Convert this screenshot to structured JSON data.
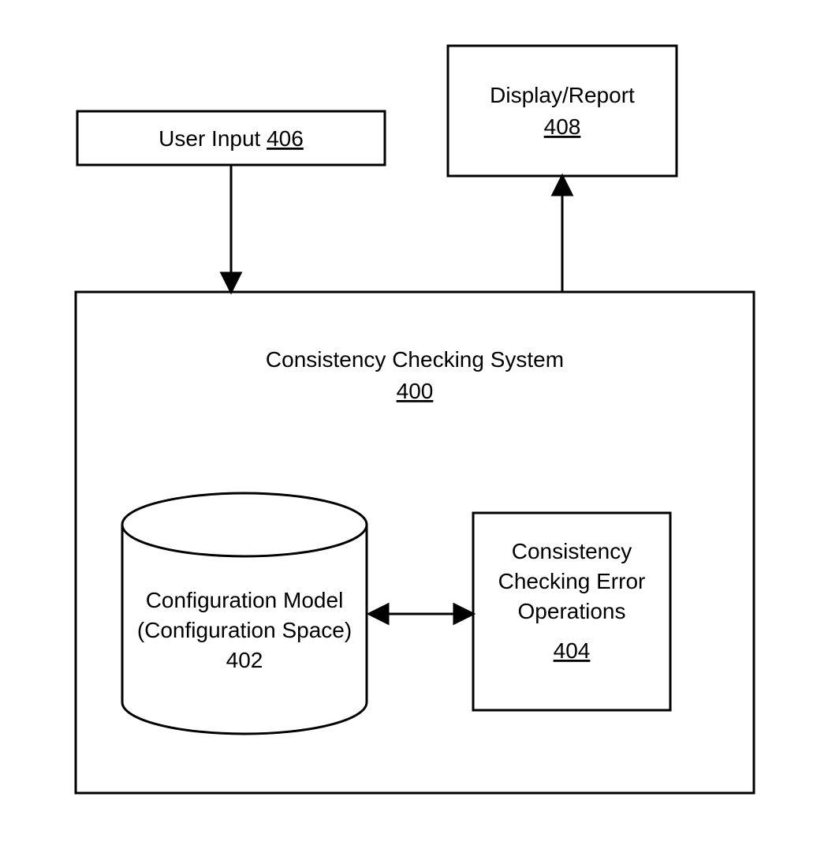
{
  "boxes": {
    "user_input": {
      "label": "User Input",
      "ref": "406"
    },
    "display_report": {
      "label_line1": "Display/Report",
      "ref": "408"
    },
    "system": {
      "label": "Consistency Checking System",
      "ref": "400"
    },
    "config_model": {
      "line1": "Configuration Model",
      "line2": "(Configuration Space)",
      "ref": "402"
    },
    "ops": {
      "line1": "Consistency",
      "line2": "Checking Error",
      "line3": "Operations",
      "ref": "404"
    }
  }
}
